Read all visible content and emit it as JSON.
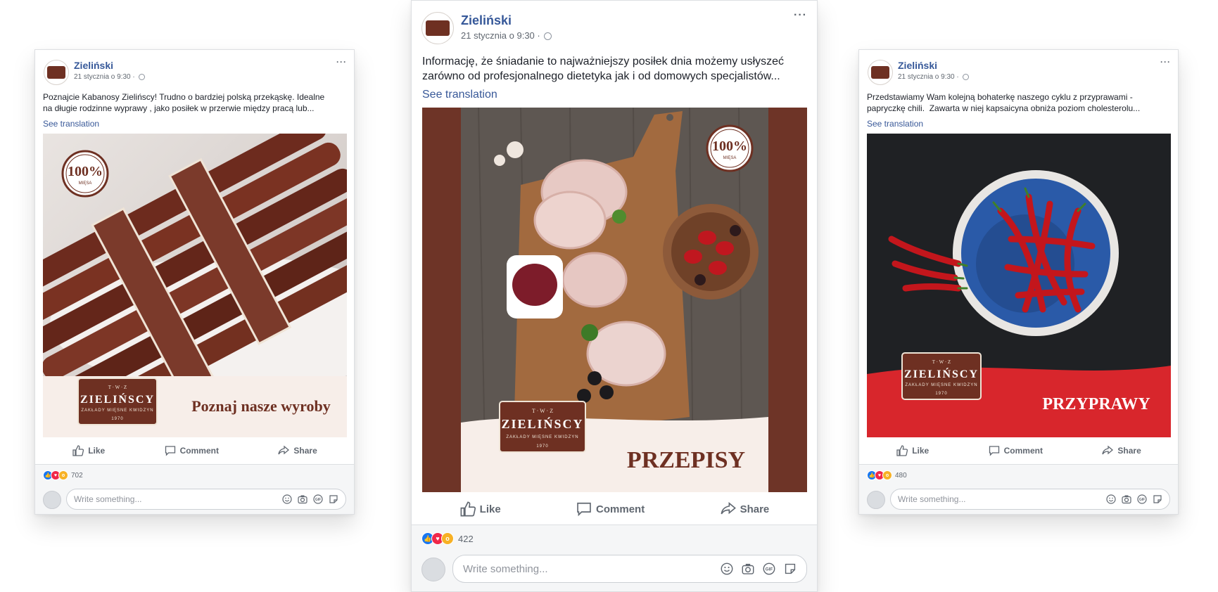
{
  "posts": [
    {
      "page_name": "Zieliński",
      "time": "21 stycznia o 9:30 ·",
      "text_line1": "Poznajcie Kabanosy Zielińscy! Trudno o bardziej polską przekąskę. Idealne",
      "text_line2": "na długie rodzinne wyprawy ⁣, jako posiłek w przerwie między pracą lub...",
      "see_translation": "See translation",
      "badge_big": "100%",
      "badge_small": "MIĘSA",
      "brand_top": "T · W · Z",
      "brand_name": "ZIELIŃSCY",
      "brand_sub": "ZAKŁADY MIĘSNE KWIDZYN",
      "brand_year": "1970",
      "banner_caption": "Poznaj nasze wyroby",
      "like": "Like",
      "comment": "Comment",
      "share": "Share",
      "reaction_count": "702",
      "comment_placeholder": "Write something..."
    },
    {
      "page_name": "Zieliński",
      "time": "21 stycznia o 9:30 ·",
      "text_line1": "Informację, że śniadanie to najważniejszy posiłek dnia możemy usłyszeć",
      "text_line2": "zarówno od profesjonalnego dietetyka jak i od domowych specjalistów...",
      "see_translation": "See translation",
      "badge_big": "100%",
      "badge_small": "MIĘSA",
      "brand_top": "T · W · Z",
      "brand_name": "ZIELIŃSCY",
      "brand_sub": "ZAKŁADY MIĘSNE KWIDZYN",
      "brand_year": "1970",
      "banner_caption": "PRZEPISY",
      "like": "Like",
      "comment": "Comment",
      "share": "Share",
      "reaction_count": "422",
      "comment_placeholder": "Write something..."
    },
    {
      "page_name": "Zieliński",
      "time": "21 stycznia o 9:30 ·",
      "text_line1": "Przedstawiamy Wam kolejną bohaterkę naszego cyklu z przyprawami -",
      "text_line2": "papryczkę chili. ⁣ Zawarta w niej kapsaicyna obniża poziom cholesterolu...",
      "see_translation": "See translation",
      "brand_top": "T · W · Z",
      "brand_name": "ZIELIŃSCY",
      "brand_sub": "ZAKŁADY MIĘSNE KWIDZYN",
      "brand_year": "1970",
      "banner_caption": "PRZYPRAWY",
      "like": "Like",
      "comment": "Comment",
      "share": "Share",
      "reaction_count": "480",
      "comment_placeholder": "Write something..."
    }
  ],
  "colors": {
    "link": "#385898",
    "brand_brown": "#6e3022",
    "chili_red": "#d8262c",
    "foot_bg": "#f5f6f7"
  },
  "icons": [
    "like-icon",
    "comment-icon",
    "share-icon",
    "globe-icon",
    "more-icon",
    "emoji-icon",
    "camera-icon",
    "gif-icon",
    "sticker-icon"
  ]
}
